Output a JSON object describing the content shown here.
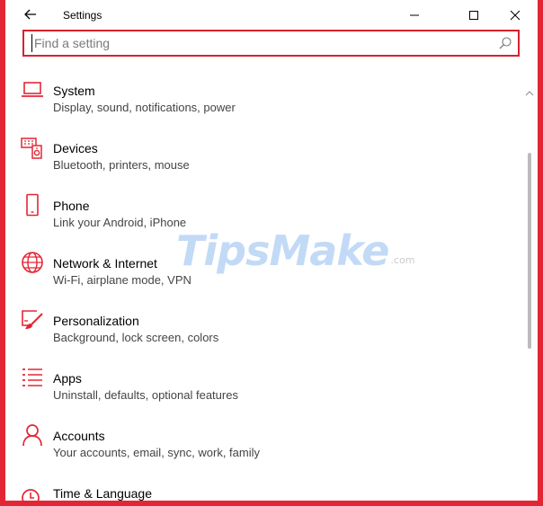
{
  "window": {
    "title": "Settings",
    "accent": "#e32636"
  },
  "search": {
    "placeholder": "Find a setting",
    "value": ""
  },
  "watermark": {
    "text": "TipsMake",
    "suffix": ".com"
  },
  "items": [
    {
      "label": "System",
      "desc": "Display, sound, notifications, power",
      "icon": "laptop-icon"
    },
    {
      "label": "Devices",
      "desc": "Bluetooth, printers, mouse",
      "icon": "devices-icon"
    },
    {
      "label": "Phone",
      "desc": "Link your Android, iPhone",
      "icon": "phone-icon"
    },
    {
      "label": "Network & Internet",
      "desc": "Wi-Fi, airplane mode, VPN",
      "icon": "globe-icon"
    },
    {
      "label": "Personalization",
      "desc": "Background, lock screen, colors",
      "icon": "paint-icon"
    },
    {
      "label": "Apps",
      "desc": "Uninstall, defaults, optional features",
      "icon": "apps-list-icon"
    },
    {
      "label": "Accounts",
      "desc": "Your accounts, email, sync, work, family",
      "icon": "person-icon"
    },
    {
      "label": "Time & Language",
      "desc": "",
      "icon": "clock-icon"
    }
  ]
}
